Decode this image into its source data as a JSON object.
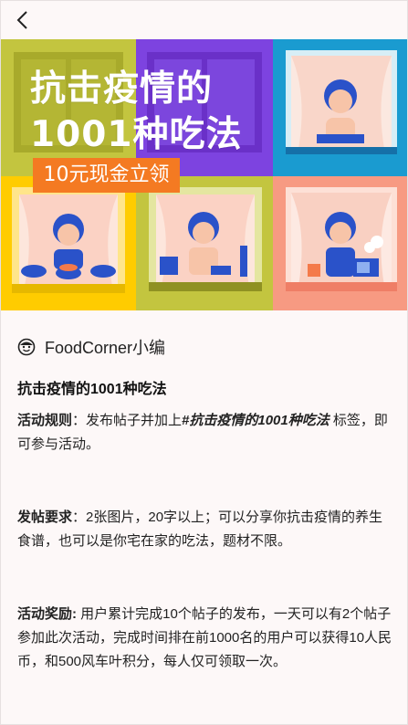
{
  "nav": {
    "back_icon": "chevron-left-icon"
  },
  "banner": {
    "title": "抗击疫情的\n1001种吃法",
    "badge": "10元现金立领",
    "colors": {
      "yellow_green": "#c3c53f",
      "purple": "#7d43e0",
      "blue": "#1a9bd0",
      "yellow": "#ffcc00",
      "salmon": "#f79a82",
      "badge": "#f47a22"
    }
  },
  "author": {
    "icon": "smiley-face-icon",
    "name": "FoodCorner小编"
  },
  "post": {
    "title": "抗击疫情的1001种吃法",
    "rules": {
      "label": "活动规则",
      "text_before": "：发布帖子并加上",
      "tag": "#抗击疫情的1001种吃法",
      "text_after": " 标签，即可参与活动。"
    },
    "requirements": {
      "label": "发帖要求",
      "text": "：2张图片，20字以上；可以分享你抗击疫情的养生食谱，也可以是你宅在家的吃法，题材不限。"
    },
    "rewards": {
      "label": "活动奖励:",
      "text": " 用户累计完成10个帖子的发布，一天可以有2个帖子参加此次活动，完成时间排在前1000名的用户可以获得10人民币，和500风车叶积分，每人仅可领取一次。"
    }
  }
}
